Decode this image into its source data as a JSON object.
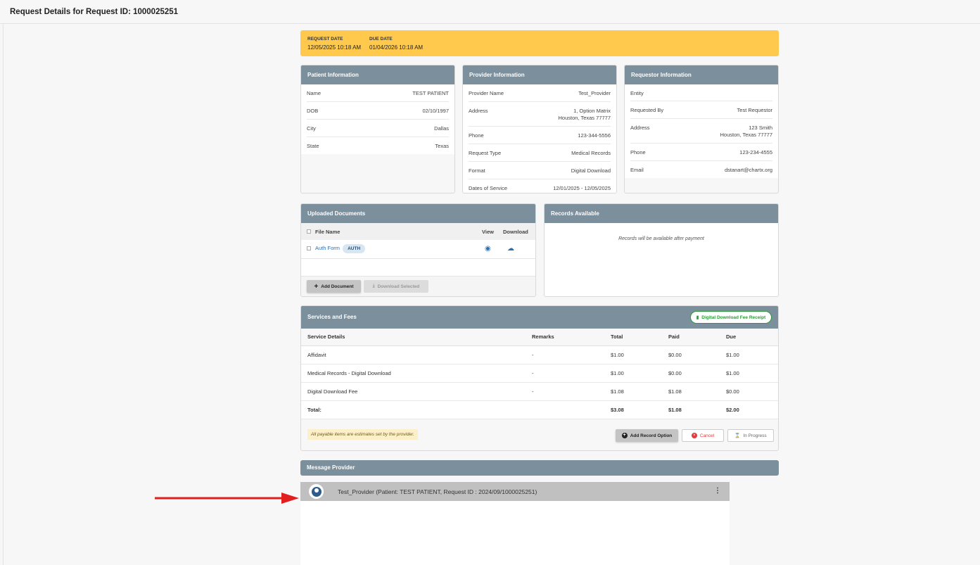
{
  "page": {
    "title": "Request Details for Request ID: 1000025251"
  },
  "banner": {
    "request_date_label": "REQUEST DATE",
    "request_date": "12/05/2025 10:18 AM",
    "due_date_label": "DUE DATE",
    "due_date": "01/04/2026 10:18 AM",
    "color": "#ffc94d"
  },
  "patient": {
    "title": "Patient Information",
    "rows": [
      {
        "k": "Name",
        "v": "TEST PATIENT"
      },
      {
        "k": "DOB",
        "v": "02/10/1997"
      },
      {
        "k": "City",
        "v": "Dallas"
      },
      {
        "k": "State",
        "v": "Texas"
      }
    ]
  },
  "provider": {
    "title": "Provider Information",
    "rows": [
      {
        "k": "Provider Name",
        "v": "Test_Provider"
      },
      {
        "k": "Address",
        "v": "1, Option Matrix",
        "v2": "Houston, Texas 77777"
      },
      {
        "k": "Phone",
        "v": "123-344-5556"
      },
      {
        "k": "Request Type",
        "v": "Medical Records"
      },
      {
        "k": "Format",
        "v": "Digital Download"
      },
      {
        "k": "Dates of Service",
        "v": "12/01/2025 - 12/05/2025"
      }
    ]
  },
  "requestor": {
    "title": "Requestor Information",
    "rows": [
      {
        "k": "Entity",
        "v": ""
      },
      {
        "k": "Requested By",
        "v": "Test Requestor"
      },
      {
        "k": "Address",
        "v": "123 Smith",
        "v2": "Houston, Texas 77777"
      },
      {
        "k": "Phone",
        "v": "123-234-4555"
      },
      {
        "k": "Email",
        "v": "dstanart@chartx.org"
      }
    ]
  },
  "documents": {
    "title": "Uploaded Documents",
    "col_file": "File Name",
    "col_view": "View",
    "col_download": "Download",
    "files": [
      {
        "name": "Auth Form",
        "badge": "AUTH"
      }
    ],
    "add_label": "Add Document",
    "download_selected_label": "Download Selected"
  },
  "records": {
    "title": "Records Available",
    "message": "Records will be available after payment"
  },
  "fees": {
    "title": "Services and Fees",
    "receipt_label": "Digital Download Fee Receipt",
    "columns": [
      "Service Details",
      "Remarks",
      "Total",
      "Paid",
      "Due"
    ],
    "rows": [
      [
        "Affidavit",
        "-",
        "$1.00",
        "$0.00",
        "$1.00"
      ],
      [
        "Medical Records - Digital Download",
        "-",
        "$1.00",
        "$0.00",
        "$1.00"
      ],
      [
        "Digital Download Fee",
        "-",
        "$1.08",
        "$1.08",
        "$0.00"
      ]
    ],
    "total": [
      "Total:",
      "",
      "$3.08",
      "$1.08",
      "$2.00"
    ],
    "note": "All payable items are estimates set by the provider.",
    "add_option_label": "Add Record Option",
    "cancel_label": "Cancel",
    "status_label": "In Progress"
  },
  "message": {
    "title": "Message Provider",
    "thread": "Test_Provider (Patient: TEST PATIENT, Request ID : 2024/09/1000025251)"
  }
}
